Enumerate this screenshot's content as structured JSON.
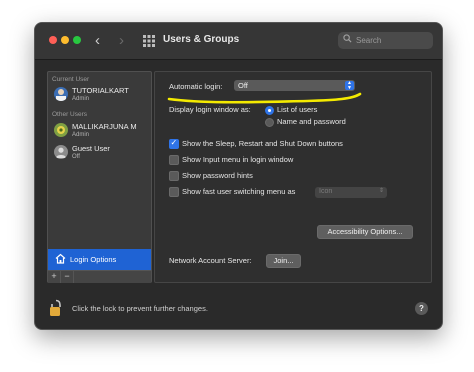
{
  "window": {
    "title": "Users & Groups"
  },
  "search": {
    "placeholder": "Search"
  },
  "sidebar": {
    "current_user_label": "Current User",
    "current_user": {
      "name": "TUTORIALKART",
      "role": "Admin"
    },
    "other_users_label": "Other Users",
    "other_users": [
      {
        "name": "MALLIKARJUNA M",
        "role": "Admin"
      },
      {
        "name": "Guest User",
        "role": "Off"
      }
    ],
    "login_options_label": "Login Options",
    "add_label": "+",
    "remove_label": "−"
  },
  "main": {
    "automatic_login_label": "Automatic login:",
    "automatic_login_value": "Off",
    "display_login_label": "Display login window as:",
    "display_options": [
      "List of users",
      "Name and password"
    ],
    "display_selected": "List of users",
    "checkboxes": [
      {
        "label": "Show the Sleep, Restart and Shut Down buttons",
        "checked": true
      },
      {
        "label": "Show Input menu in login window",
        "checked": false
      },
      {
        "label": "Show password hints",
        "checked": false
      },
      {
        "label": "Show fast user switching menu as",
        "checked": false
      }
    ],
    "switching_menu_value": "Icon",
    "accessibility_button": "Accessibility Options...",
    "network_server_label": "Network Account Server:",
    "join_button": "Join..."
  },
  "footer": {
    "lock_text": "Click the lock to prevent further changes.",
    "help_label": "?"
  },
  "colors": {
    "accent": "#2f74e8",
    "selection": "#1f63d4",
    "highlighter": "#f4ea00"
  }
}
